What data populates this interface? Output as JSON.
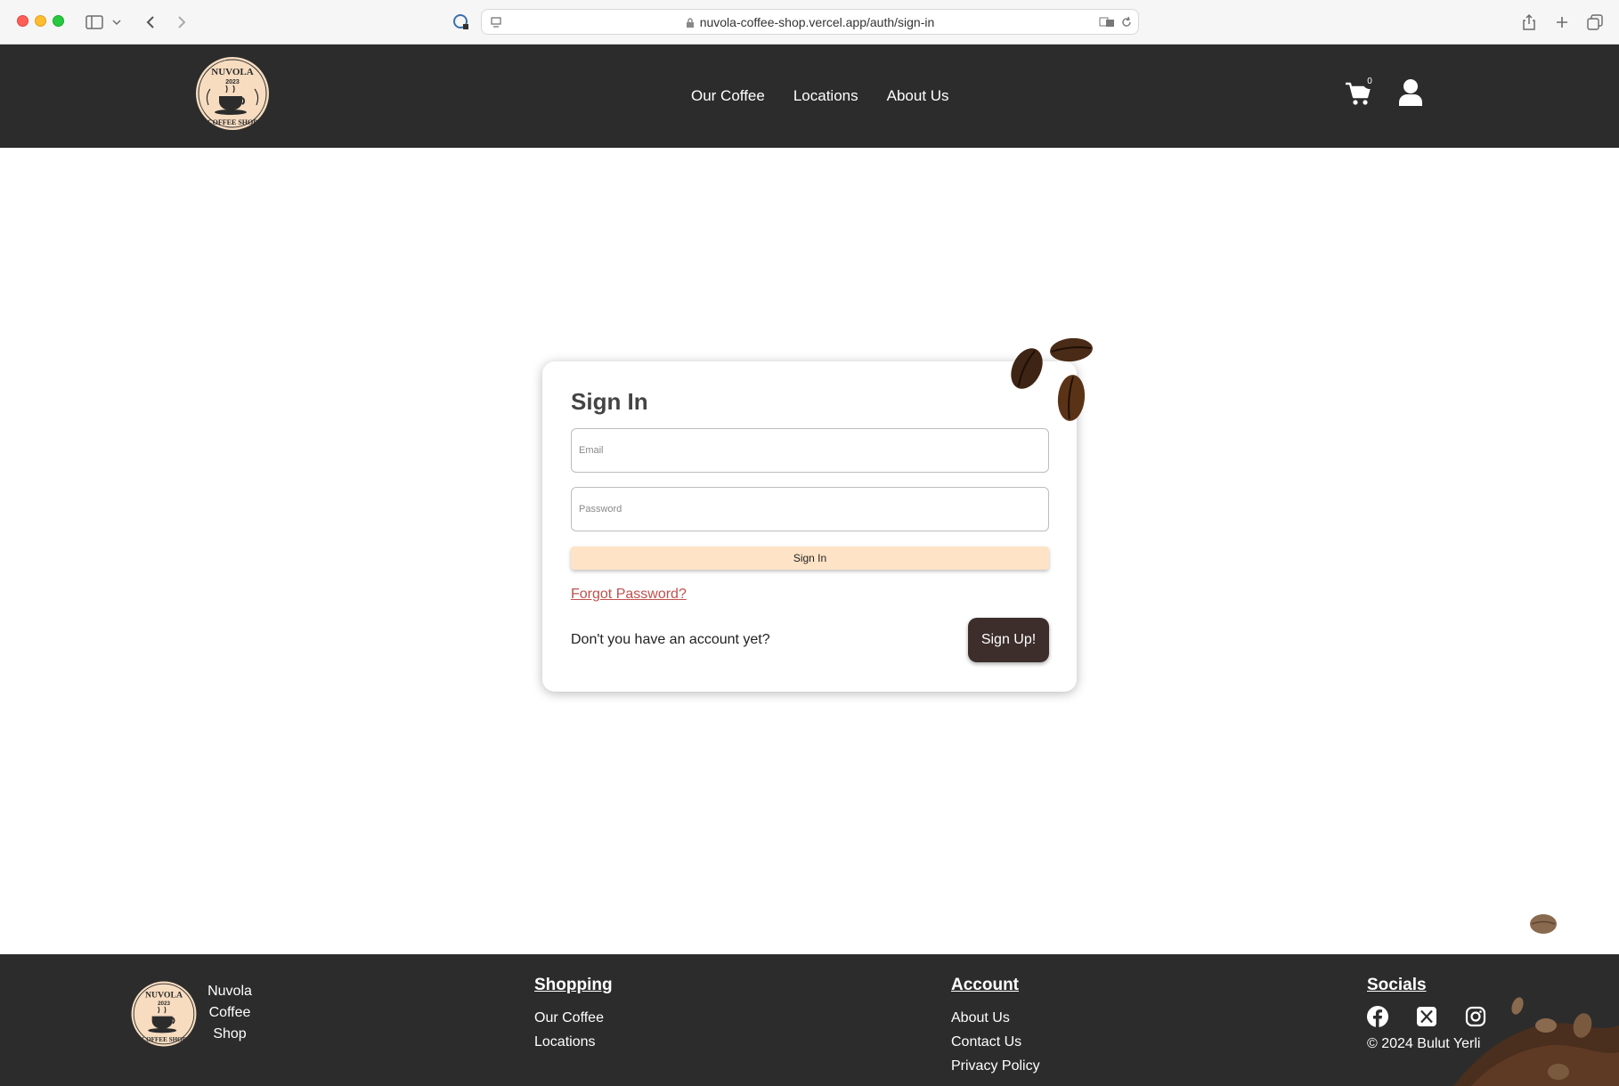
{
  "browser": {
    "url": "nuvola-coffee-shop.vercel.app/auth/sign-in"
  },
  "header": {
    "logo_text": "NUVOLA",
    "logo_year": "2023",
    "logo_subtext": "COFFEE SHOP",
    "nav": [
      {
        "label": "Our Coffee"
      },
      {
        "label": "Locations"
      },
      {
        "label": "About Us"
      }
    ],
    "cart_count": "0"
  },
  "signin": {
    "title": "Sign In",
    "email_placeholder": "Email",
    "password_placeholder": "Password",
    "submit_label": "Sign In",
    "forgot_label": "Forgot Password?",
    "no_account_text": "Don't you have an account yet?",
    "signup_label": "Sign Up!"
  },
  "footer": {
    "brand_lines": [
      "Nuvola",
      "Coffee",
      "Shop"
    ],
    "shopping": {
      "heading": "Shopping",
      "links": [
        "Our Coffee",
        "Locations"
      ]
    },
    "account": {
      "heading": "Account",
      "links": [
        "About Us",
        "Contact Us",
        "Privacy Policy"
      ]
    },
    "socials": {
      "heading": "Socials",
      "icons": [
        "facebook-icon",
        "x-icon",
        "instagram-icon"
      ]
    },
    "copyright": "© 2024 Bulut Yerli"
  },
  "colors": {
    "header_bg": "#2c2c2c",
    "signin_button": "#ffe3c6",
    "signup_button": "#3d2e2b",
    "forgot_link": "#c0504d"
  }
}
